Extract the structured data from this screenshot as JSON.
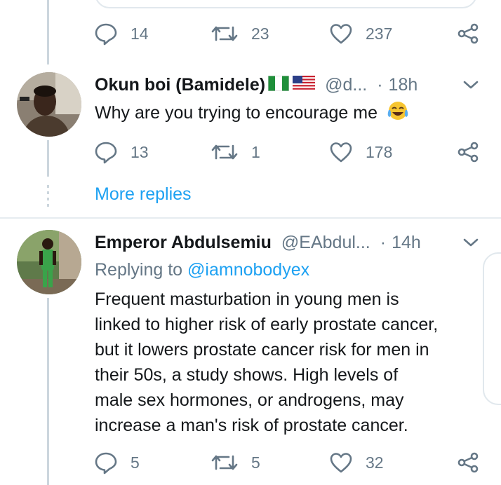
{
  "top_tweet": {
    "replies_count": "14",
    "retweets_count": "23",
    "likes_count": "237"
  },
  "reply1": {
    "name": "Okun boi (Bamidele)",
    "handle": "@d...",
    "dot": "·",
    "time": "18h",
    "text": "Why are you trying to encourage me",
    "emoji": "😂",
    "replies_count": "13",
    "retweets_count": "1",
    "likes_count": "178"
  },
  "more_replies_label": "More replies",
  "reply2": {
    "name": "Emperor Abdulsemiu",
    "handle": "@EAbdul...",
    "dot": "·",
    "time": "14h",
    "replying_prefix": "Replying to ",
    "replying_mention": "@iamnobodyex",
    "text_lines": [
      "Frequent masturbation in young men is",
      "linked to higher risk of early prostate cancer,",
      "but it lowers prostate cancer risk for men in",
      "their 50s, a study shows. High levels of",
      "male sex hormones, or androgens, may",
      "increase a man's risk of prostate cancer."
    ],
    "replies_count": "5",
    "retweets_count": "5",
    "likes_count": "32"
  },
  "colors": {
    "accent": "#1da1f2",
    "muted": "#657786",
    "line": "#ccd6dd",
    "text": "#14171a"
  },
  "icons": [
    "reply-icon",
    "retweet-icon",
    "like-icon",
    "share-icon",
    "chevron-down-icon",
    "flag-nigeria-icon",
    "flag-usa-icon",
    "tears-of-joy-emoji"
  ]
}
